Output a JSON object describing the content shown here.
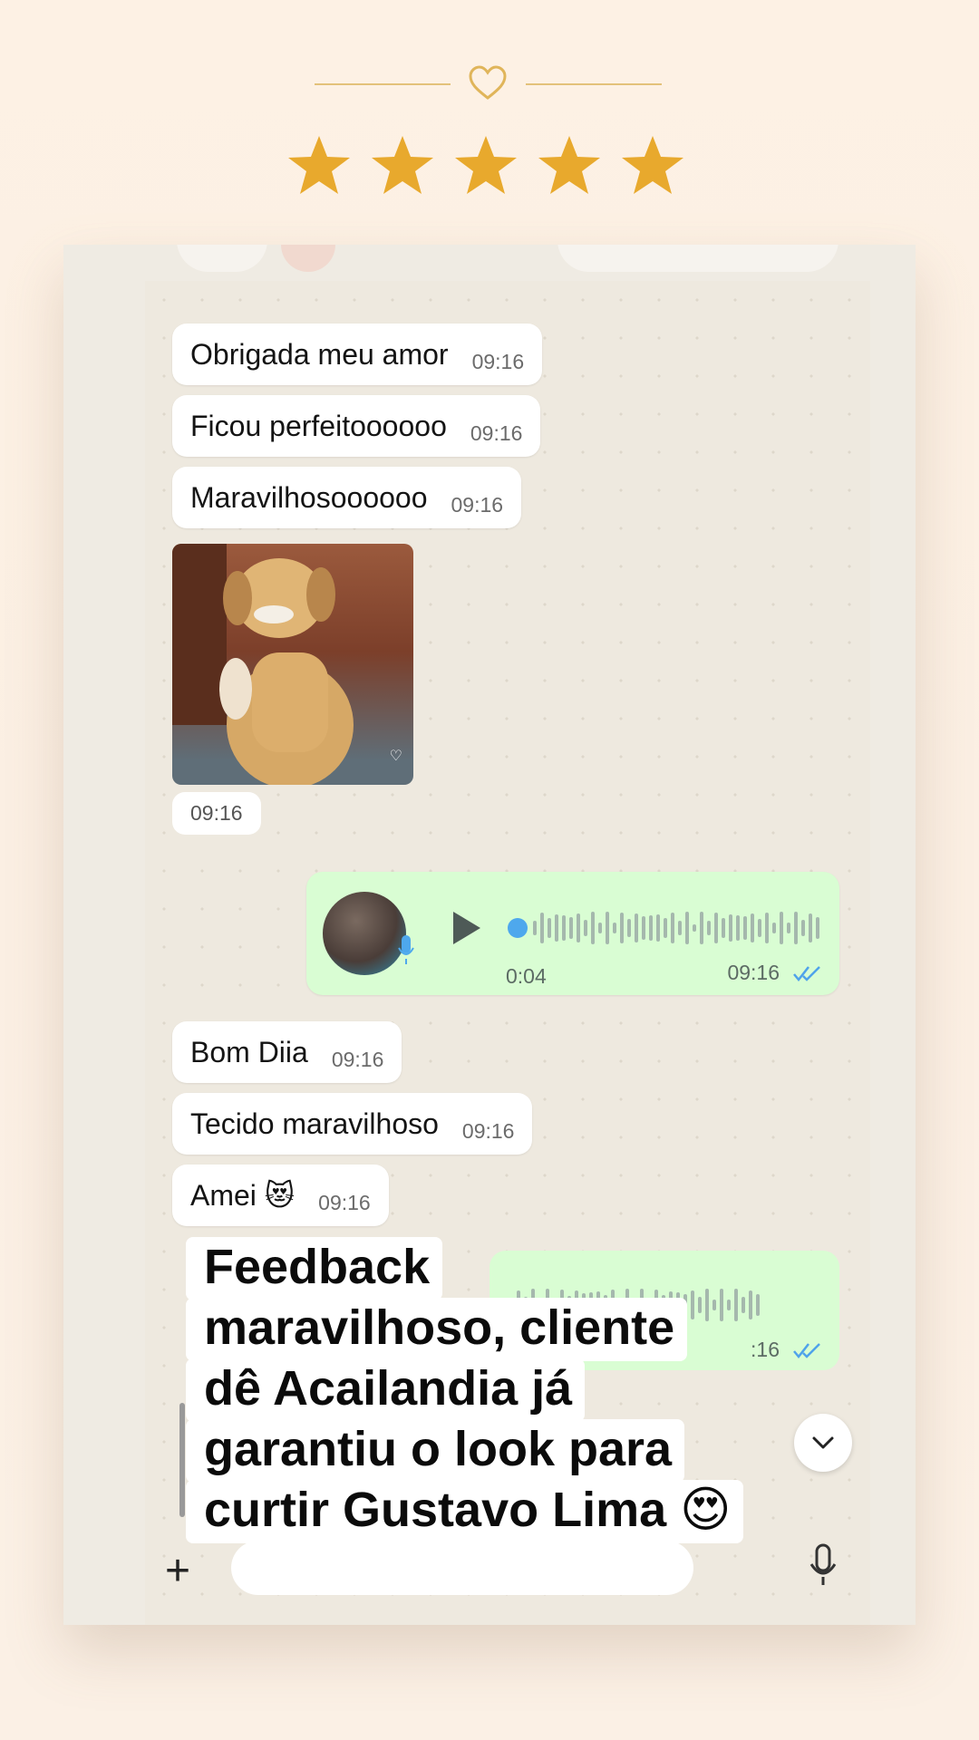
{
  "decor": {
    "heart_icon": "heart-outline-icon",
    "line_color": "#e3c27a"
  },
  "rating": {
    "stars": 5,
    "max": 5,
    "color": "#e8a92d"
  },
  "chat": {
    "messages": [
      {
        "text": "Obrigada meu amor",
        "time": "09:16"
      },
      {
        "text": "Ficou perfeitoooooo",
        "time": "09:16"
      },
      {
        "text": "Maravilhosoooooo",
        "time": "09:16"
      }
    ],
    "image_message": {
      "time": "09:16"
    },
    "voice_message": {
      "duration": "0:04",
      "time": "09:16",
      "status_icon": "double-check-icon"
    },
    "messages2": [
      {
        "text": "Bom Diia",
        "time": "09:16"
      },
      {
        "text": "Tecido maravilhoso",
        "time": "09:16"
      },
      {
        "text": "Amei 😻",
        "time": "09:16"
      }
    ],
    "voice_message_2": {
      "time_partial": ":16",
      "status_icon": "double-check-icon"
    }
  },
  "caption": {
    "lines": [
      "Feedback",
      "maravilhoso, cliente",
      "dê Acailandia já",
      "garantiu o look para",
      "curtir Gustavo Lima 😍"
    ]
  },
  "colors": {
    "outgoing_bubble": "#d9fdd3",
    "incoming_bubble": "#ffffff",
    "check_blue": "#4fa3ea"
  }
}
